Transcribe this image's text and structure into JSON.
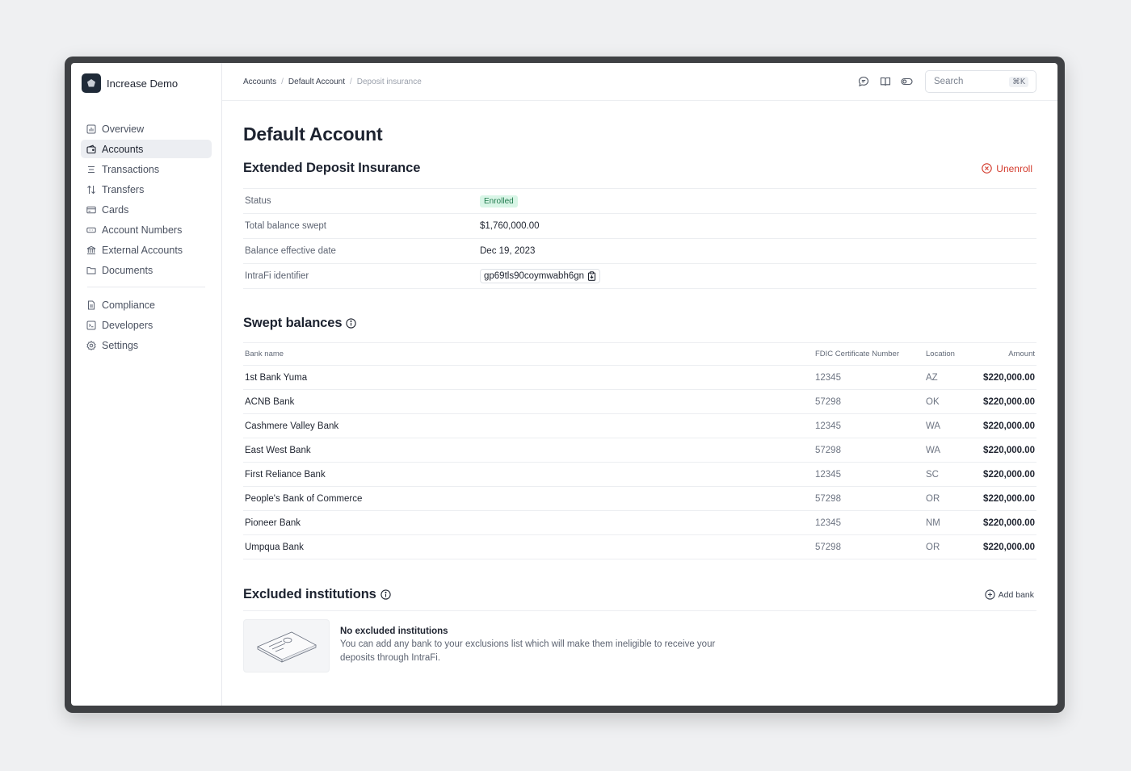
{
  "app": {
    "name": "Increase Demo"
  },
  "sidebar": {
    "items": [
      {
        "label": "Overview",
        "icon": "chart-icon",
        "active": false
      },
      {
        "label": "Accounts",
        "icon": "wallet-icon",
        "active": true
      },
      {
        "label": "Transactions",
        "icon": "list-icon",
        "active": false
      },
      {
        "label": "Transfers",
        "icon": "arrows-updown-icon",
        "active": false
      },
      {
        "label": "Cards",
        "icon": "credit-card-icon",
        "active": false
      },
      {
        "label": "Account Numbers",
        "icon": "number-card-icon",
        "active": false
      },
      {
        "label": "External Accounts",
        "icon": "bank-icon",
        "active": false
      },
      {
        "label": "Documents",
        "icon": "folder-icon",
        "active": false
      }
    ],
    "secondary": [
      {
        "label": "Compliance",
        "icon": "document-icon"
      },
      {
        "label": "Developers",
        "icon": "terminal-icon"
      },
      {
        "label": "Settings",
        "icon": "gear-icon"
      }
    ]
  },
  "header": {
    "breadcrumb": [
      "Accounts",
      "Default Account",
      "Deposit insurance"
    ],
    "search_placeholder": "Search",
    "search_shortcut": "⌘K"
  },
  "page": {
    "title": "Default Account"
  },
  "insurance": {
    "title": "Extended Deposit Insurance",
    "unenroll_label": "Unenroll",
    "rows": {
      "status_label": "Status",
      "status_value": "Enrolled",
      "balance_label": "Total balance swept",
      "balance_value": "$1,760,000.00",
      "date_label": "Balance effective date",
      "date_value": "Dec 19, 2023",
      "id_label": "IntraFi identifier",
      "id_value": "gp69tls90coymwabh6gn"
    }
  },
  "swept": {
    "title": "Swept balances",
    "columns": [
      "Bank name",
      "FDIC Certificate Number",
      "Location",
      "Amount"
    ],
    "rows": [
      {
        "bank": "1st Bank Yuma",
        "fdic": "12345",
        "location": "AZ",
        "amount": "$220,000.00"
      },
      {
        "bank": "ACNB Bank",
        "fdic": "57298",
        "location": "OK",
        "amount": "$220,000.00"
      },
      {
        "bank": "Cashmere Valley Bank",
        "fdic": "12345",
        "location": "WA",
        "amount": "$220,000.00"
      },
      {
        "bank": "East West Bank",
        "fdic": "57298",
        "location": "WA",
        "amount": "$220,000.00"
      },
      {
        "bank": "First Reliance Bank",
        "fdic": "12345",
        "location": "SC",
        "amount": "$220,000.00"
      },
      {
        "bank": "People's Bank of Commerce",
        "fdic": "57298",
        "location": "OR",
        "amount": "$220,000.00"
      },
      {
        "bank": "Pioneer Bank",
        "fdic": "12345",
        "location": "NM",
        "amount": "$220,000.00"
      },
      {
        "bank": "Umpqua Bank",
        "fdic": "57298",
        "location": "OR",
        "amount": "$220,000.00"
      }
    ]
  },
  "excluded": {
    "title": "Excluded institutions",
    "add_label": "Add bank",
    "empty_title": "No excluded institutions",
    "empty_desc": "You can add any bank to your exclusions list which will make them ineligible to receive your deposits through IntraFi."
  },
  "colors": {
    "accent_danger": "#d33a2c",
    "badge_bg": "#d8f5e6",
    "badge_text": "#1f7a4d",
    "logo_bg": "#1f2a38"
  }
}
